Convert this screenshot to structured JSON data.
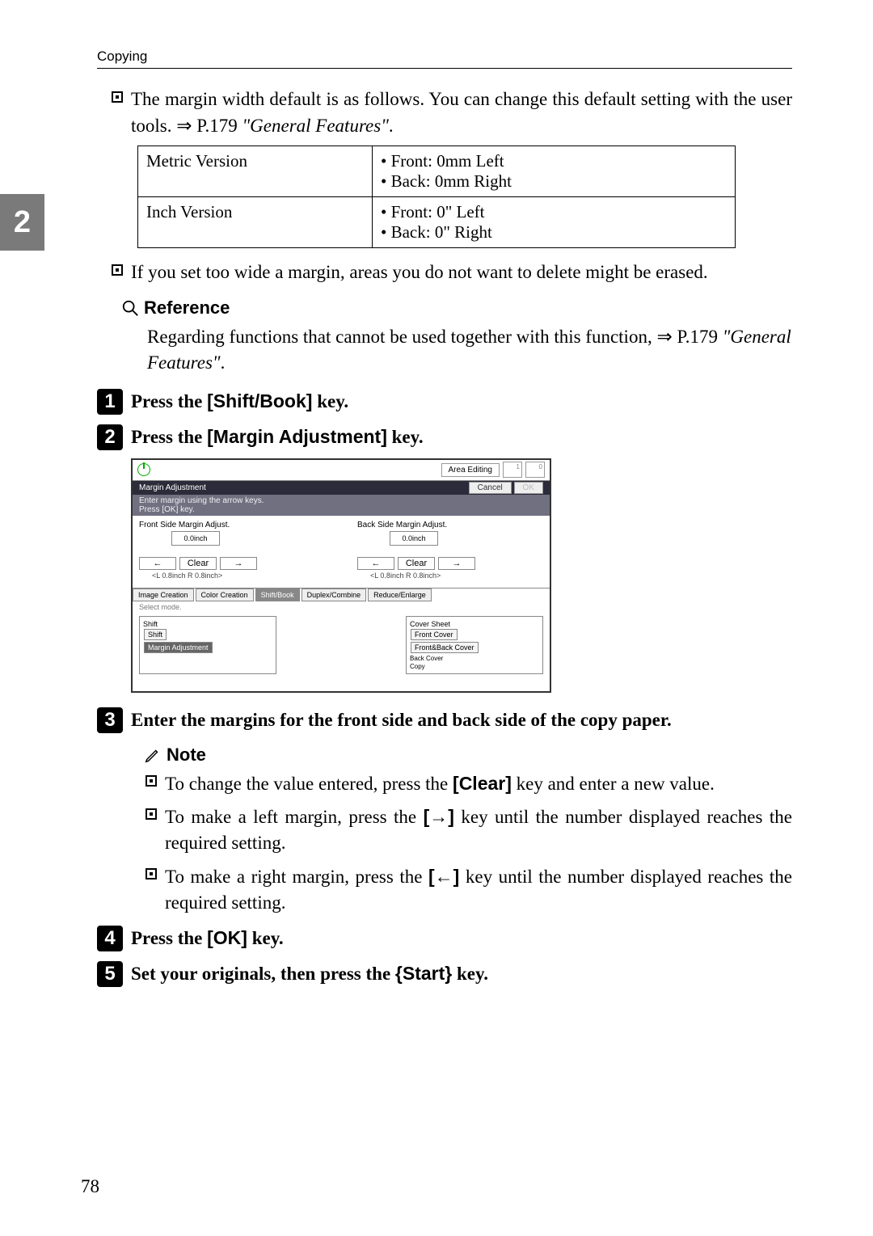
{
  "header": {
    "section": "Copying"
  },
  "side_tab": "2",
  "para1": {
    "text_a": "The margin width default is as follows. You can change this default setting with the user tools. ",
    "arrow": "⇒",
    "text_b": " P.179 ",
    "ref": "\"General Features\"",
    "dot": "."
  },
  "defaults_table": {
    "rows": [
      {
        "label": "Metric Version",
        "items": [
          "Front: 0mm Left",
          "Back: 0mm Right"
        ]
      },
      {
        "label": "Inch Version",
        "items": [
          "Front: 0\" Left",
          "Back: 0\" Right"
        ]
      }
    ]
  },
  "para2": "If you set too wide a margin, areas you do not want to delete might be erased.",
  "reference": {
    "heading": "Reference",
    "body_a": "Regarding functions that cannot be used together with this function, ",
    "arrow": "⇒",
    "body_b": " P.179 ",
    "ref": "\"General Features\"",
    "dot": "."
  },
  "steps": {
    "s1": {
      "pre": "Press the ",
      "key": "[Shift/Book]",
      "post": " key."
    },
    "s2": {
      "pre": "Press the ",
      "key": "[Margin Adjustment]",
      "post": " key."
    },
    "s3": {
      "text": "Enter the margins for the front side and back side of the copy paper."
    },
    "s4": {
      "pre": "Press the ",
      "key": "[OK]",
      "post": " key."
    },
    "s5": {
      "pre": "Set your originals, then press the ",
      "key_open": "{",
      "key": "Start",
      "key_close": "}",
      "post": " key."
    }
  },
  "screenshot": {
    "area_editing": "Area Editing",
    "badge1": "1",
    "badge2": "0",
    "dark_title": "Margin Adjustment",
    "cancel": "Cancel",
    "ok": "OK",
    "gray_instr": "Enter margin using the arrow keys.\nPress [OK] key.",
    "front_label": "Front Side Margin Adjust.",
    "back_label": "Back Side Margin Adjust.",
    "val": "0.0inch",
    "clear": "Clear",
    "left_arrow": "←",
    "right_arrow": "→",
    "range_l": "<L 0.8inch  R 0.8inch>",
    "range_r": "<L 0.8inch  R 0.8inch>",
    "tabs": [
      "Image Creation",
      "Color Creation",
      "Shift/Book",
      "Duplex/Combine",
      "Reduce/Enlarge"
    ],
    "select_mode": "Select mode.",
    "shift_panel": "Shift",
    "shift_btn": "Shift",
    "margin_adj_btn": "Margin Adjustment",
    "cover_sheet": "Cover Sheet",
    "front_cover": "Front Cover",
    "front_back_cover": "Front&Back Cover",
    "back_cover_copy": "Back Cover\nCopy"
  },
  "note": {
    "heading": "Note",
    "items": [
      {
        "pre": "To change the value entered, press the ",
        "key": "[Clear]",
        "post": " key and enter a new value."
      },
      {
        "pre": "To make a left margin, press the ",
        "key": "[→]",
        "post": " key until the number displayed reaches the required setting."
      },
      {
        "pre": "To make a right margin, press the ",
        "key": "[←]",
        "post": " key until the number displayed reaches the required setting."
      }
    ]
  },
  "page_number": "78"
}
